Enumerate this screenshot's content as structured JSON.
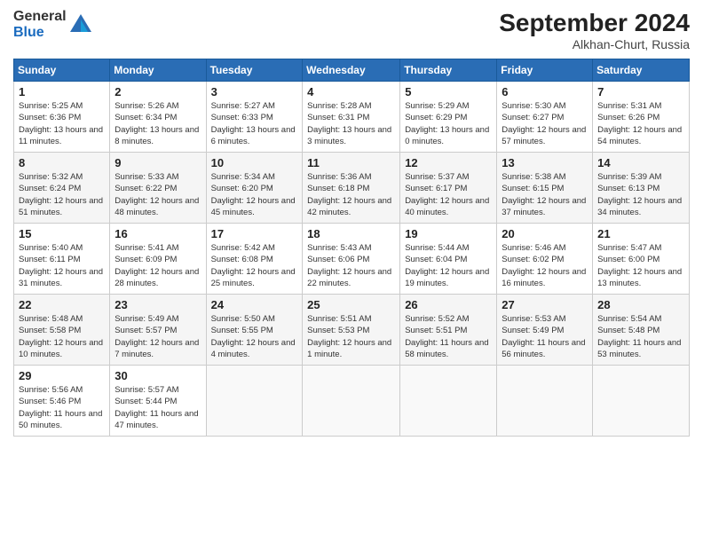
{
  "header": {
    "logo_general": "General",
    "logo_blue": "Blue",
    "month_title": "September 2024",
    "subtitle": "Alkhan-Churt, Russia"
  },
  "weekdays": [
    "Sunday",
    "Monday",
    "Tuesday",
    "Wednesday",
    "Thursday",
    "Friday",
    "Saturday"
  ],
  "weeks": [
    [
      {
        "day": "1",
        "sunrise": "Sunrise: 5:25 AM",
        "sunset": "Sunset: 6:36 PM",
        "daylight": "Daylight: 13 hours and 11 minutes."
      },
      {
        "day": "2",
        "sunrise": "Sunrise: 5:26 AM",
        "sunset": "Sunset: 6:34 PM",
        "daylight": "Daylight: 13 hours and 8 minutes."
      },
      {
        "day": "3",
        "sunrise": "Sunrise: 5:27 AM",
        "sunset": "Sunset: 6:33 PM",
        "daylight": "Daylight: 13 hours and 6 minutes."
      },
      {
        "day": "4",
        "sunrise": "Sunrise: 5:28 AM",
        "sunset": "Sunset: 6:31 PM",
        "daylight": "Daylight: 13 hours and 3 minutes."
      },
      {
        "day": "5",
        "sunrise": "Sunrise: 5:29 AM",
        "sunset": "Sunset: 6:29 PM",
        "daylight": "Daylight: 13 hours and 0 minutes."
      },
      {
        "day": "6",
        "sunrise": "Sunrise: 5:30 AM",
        "sunset": "Sunset: 6:27 PM",
        "daylight": "Daylight: 12 hours and 57 minutes."
      },
      {
        "day": "7",
        "sunrise": "Sunrise: 5:31 AM",
        "sunset": "Sunset: 6:26 PM",
        "daylight": "Daylight: 12 hours and 54 minutes."
      }
    ],
    [
      {
        "day": "8",
        "sunrise": "Sunrise: 5:32 AM",
        "sunset": "Sunset: 6:24 PM",
        "daylight": "Daylight: 12 hours and 51 minutes."
      },
      {
        "day": "9",
        "sunrise": "Sunrise: 5:33 AM",
        "sunset": "Sunset: 6:22 PM",
        "daylight": "Daylight: 12 hours and 48 minutes."
      },
      {
        "day": "10",
        "sunrise": "Sunrise: 5:34 AM",
        "sunset": "Sunset: 6:20 PM",
        "daylight": "Daylight: 12 hours and 45 minutes."
      },
      {
        "day": "11",
        "sunrise": "Sunrise: 5:36 AM",
        "sunset": "Sunset: 6:18 PM",
        "daylight": "Daylight: 12 hours and 42 minutes."
      },
      {
        "day": "12",
        "sunrise": "Sunrise: 5:37 AM",
        "sunset": "Sunset: 6:17 PM",
        "daylight": "Daylight: 12 hours and 40 minutes."
      },
      {
        "day": "13",
        "sunrise": "Sunrise: 5:38 AM",
        "sunset": "Sunset: 6:15 PM",
        "daylight": "Daylight: 12 hours and 37 minutes."
      },
      {
        "day": "14",
        "sunrise": "Sunrise: 5:39 AM",
        "sunset": "Sunset: 6:13 PM",
        "daylight": "Daylight: 12 hours and 34 minutes."
      }
    ],
    [
      {
        "day": "15",
        "sunrise": "Sunrise: 5:40 AM",
        "sunset": "Sunset: 6:11 PM",
        "daylight": "Daylight: 12 hours and 31 minutes."
      },
      {
        "day": "16",
        "sunrise": "Sunrise: 5:41 AM",
        "sunset": "Sunset: 6:09 PM",
        "daylight": "Daylight: 12 hours and 28 minutes."
      },
      {
        "day": "17",
        "sunrise": "Sunrise: 5:42 AM",
        "sunset": "Sunset: 6:08 PM",
        "daylight": "Daylight: 12 hours and 25 minutes."
      },
      {
        "day": "18",
        "sunrise": "Sunrise: 5:43 AM",
        "sunset": "Sunset: 6:06 PM",
        "daylight": "Daylight: 12 hours and 22 minutes."
      },
      {
        "day": "19",
        "sunrise": "Sunrise: 5:44 AM",
        "sunset": "Sunset: 6:04 PM",
        "daylight": "Daylight: 12 hours and 19 minutes."
      },
      {
        "day": "20",
        "sunrise": "Sunrise: 5:46 AM",
        "sunset": "Sunset: 6:02 PM",
        "daylight": "Daylight: 12 hours and 16 minutes."
      },
      {
        "day": "21",
        "sunrise": "Sunrise: 5:47 AM",
        "sunset": "Sunset: 6:00 PM",
        "daylight": "Daylight: 12 hours and 13 minutes."
      }
    ],
    [
      {
        "day": "22",
        "sunrise": "Sunrise: 5:48 AM",
        "sunset": "Sunset: 5:58 PM",
        "daylight": "Daylight: 12 hours and 10 minutes."
      },
      {
        "day": "23",
        "sunrise": "Sunrise: 5:49 AM",
        "sunset": "Sunset: 5:57 PM",
        "daylight": "Daylight: 12 hours and 7 minutes."
      },
      {
        "day": "24",
        "sunrise": "Sunrise: 5:50 AM",
        "sunset": "Sunset: 5:55 PM",
        "daylight": "Daylight: 12 hours and 4 minutes."
      },
      {
        "day": "25",
        "sunrise": "Sunrise: 5:51 AM",
        "sunset": "Sunset: 5:53 PM",
        "daylight": "Daylight: 12 hours and 1 minute."
      },
      {
        "day": "26",
        "sunrise": "Sunrise: 5:52 AM",
        "sunset": "Sunset: 5:51 PM",
        "daylight": "Daylight: 11 hours and 58 minutes."
      },
      {
        "day": "27",
        "sunrise": "Sunrise: 5:53 AM",
        "sunset": "Sunset: 5:49 PM",
        "daylight": "Daylight: 11 hours and 56 minutes."
      },
      {
        "day": "28",
        "sunrise": "Sunrise: 5:54 AM",
        "sunset": "Sunset: 5:48 PM",
        "daylight": "Daylight: 11 hours and 53 minutes."
      }
    ],
    [
      {
        "day": "29",
        "sunrise": "Sunrise: 5:56 AM",
        "sunset": "Sunset: 5:46 PM",
        "daylight": "Daylight: 11 hours and 50 minutes."
      },
      {
        "day": "30",
        "sunrise": "Sunrise: 5:57 AM",
        "sunset": "Sunset: 5:44 PM",
        "daylight": "Daylight: 11 hours and 47 minutes."
      },
      null,
      null,
      null,
      null,
      null
    ]
  ]
}
